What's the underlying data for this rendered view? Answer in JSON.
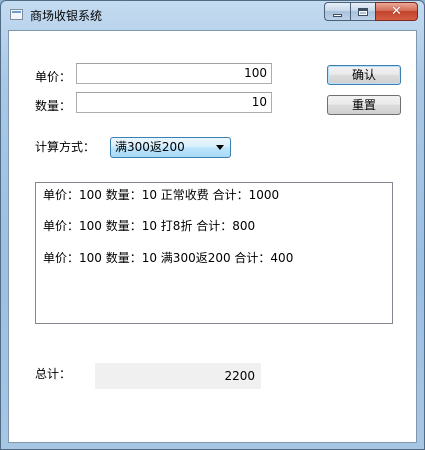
{
  "window": {
    "title": "商场收银系统"
  },
  "form": {
    "price_label": "单价：",
    "price_value": "100",
    "qty_label": "数量：",
    "qty_value": "10",
    "calc_label": "计算方式：",
    "calc_selected": "满300返200"
  },
  "buttons": {
    "confirm": "确认",
    "reset": "重置"
  },
  "records": [
    "单价：100 数量：10 正常收费 合计：1000",
    "单价：100 数量：10 打8折 合计：800",
    "单价：100 数量：10 满300返200 合计：400"
  ],
  "total": {
    "label": "总计：",
    "value": "2200"
  }
}
